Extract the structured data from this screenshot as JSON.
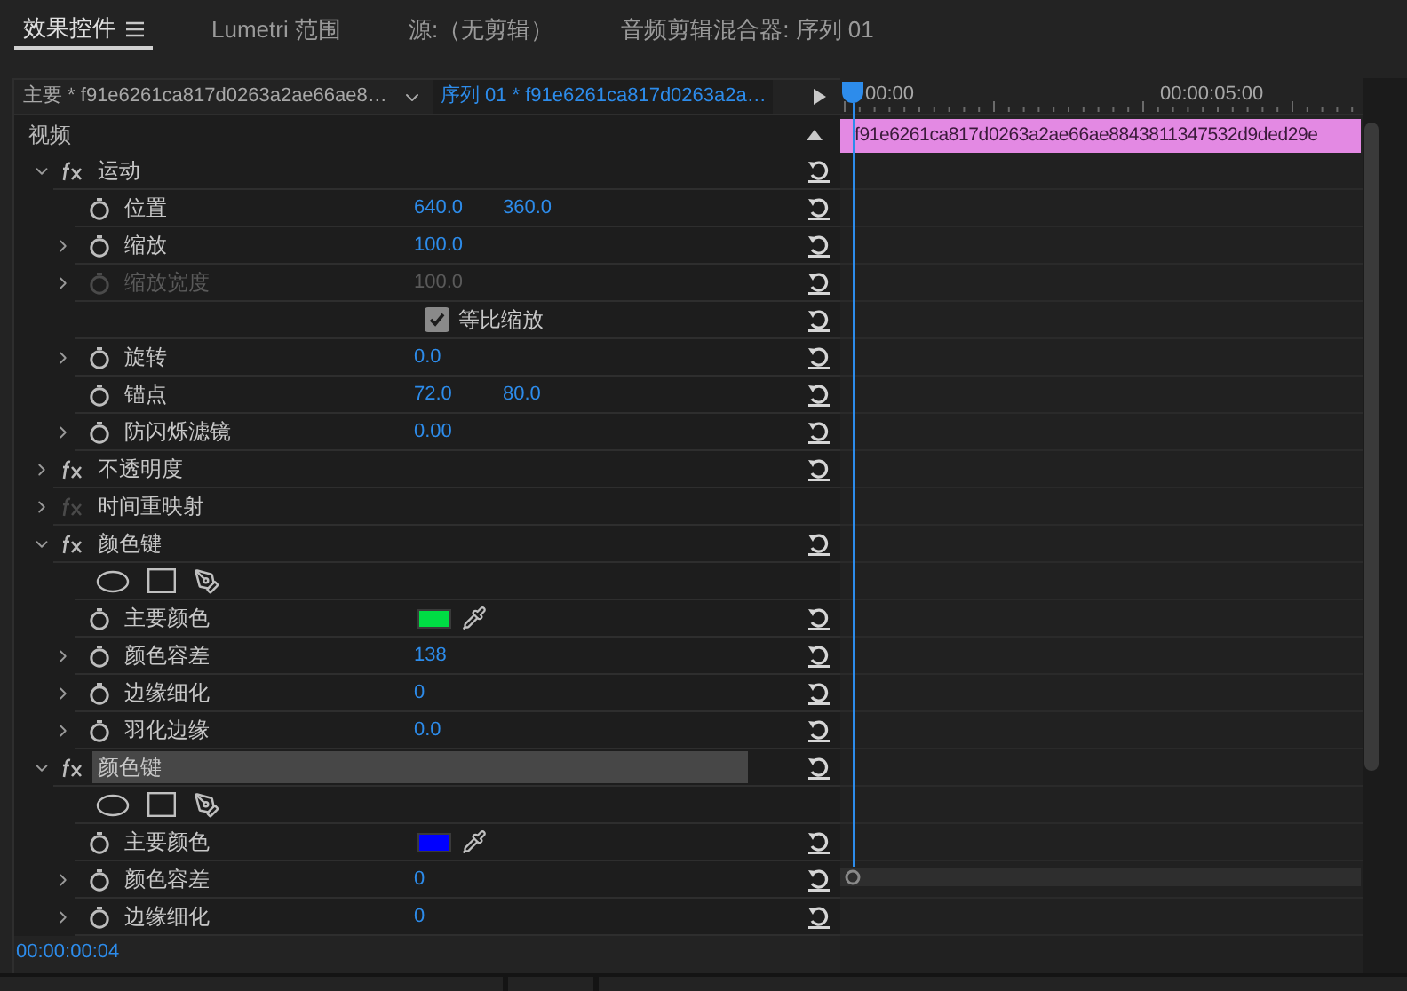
{
  "tabs": [
    {
      "label": "效果控件",
      "selected": true,
      "has_menu": true
    },
    {
      "label": "Lumetri 范围",
      "selected": false,
      "has_menu": false
    },
    {
      "label": "源:（无剪辑）",
      "selected": false,
      "has_menu": false
    },
    {
      "label": "音频剪辑混合器: 序列 01",
      "selected": false,
      "has_menu": false
    }
  ],
  "header": {
    "source": "主要 * f91e6261ca817d0263a2ae66ae8…",
    "sequence": "序列 01 * f91e6261ca817d0263a2a…"
  },
  "section": {
    "label": "视频"
  },
  "effects": [
    {
      "name": "运动",
      "expanded": true,
      "selected": false,
      "dimmed": false,
      "children": [
        {
          "kind": "value",
          "label": "位置",
          "expandable": false,
          "disabled": false,
          "values": [
            "640.0",
            "360.0"
          ]
        },
        {
          "kind": "value",
          "label": "缩放",
          "expandable": true,
          "disabled": false,
          "values": [
            "100.0"
          ]
        },
        {
          "kind": "value",
          "label": "缩放宽度",
          "expandable": true,
          "disabled": true,
          "values": [
            "100.0"
          ]
        },
        {
          "kind": "checkbox",
          "label": "等比缩放",
          "checked": true
        },
        {
          "kind": "value",
          "label": "旋转",
          "expandable": true,
          "disabled": false,
          "values": [
            "0.0"
          ]
        },
        {
          "kind": "value",
          "label": "锚点",
          "expandable": false,
          "disabled": false,
          "values": [
            "72.0",
            "80.0"
          ]
        },
        {
          "kind": "value",
          "label": "防闪烁滤镜",
          "expandable": true,
          "disabled": false,
          "values": [
            "0.00"
          ]
        }
      ]
    },
    {
      "name": "不透明度",
      "expanded": false,
      "selected": false,
      "dimmed": false
    },
    {
      "name": "时间重映射",
      "expanded": false,
      "selected": false,
      "dimmed": true
    },
    {
      "name": "颜色键",
      "expanded": true,
      "selected": false,
      "dimmed": false,
      "children": [
        {
          "kind": "mask_tools"
        },
        {
          "kind": "color",
          "label": "主要颜色",
          "color": "#00dd44"
        },
        {
          "kind": "value",
          "label": "颜色容差",
          "expandable": true,
          "disabled": false,
          "values": [
            "138"
          ]
        },
        {
          "kind": "value",
          "label": "边缘细化",
          "expandable": true,
          "disabled": false,
          "values": [
            "0"
          ]
        },
        {
          "kind": "value",
          "label": "羽化边缘",
          "expandable": true,
          "disabled": false,
          "values": [
            "0.0"
          ]
        }
      ]
    },
    {
      "name": "颜色键",
      "expanded": true,
      "selected": true,
      "dimmed": false,
      "children": [
        {
          "kind": "mask_tools"
        },
        {
          "kind": "color",
          "label": "主要颜色",
          "color": "#0000ff"
        },
        {
          "kind": "value",
          "label": "颜色容差",
          "expandable": true,
          "disabled": false,
          "values": [
            "0"
          ]
        },
        {
          "kind": "value",
          "label": "边缘细化",
          "expandable": true,
          "disabled": false,
          "values": [
            "0"
          ]
        }
      ]
    }
  ],
  "timeline": {
    "ruler": [
      "00:00",
      "00:00:05:00"
    ],
    "clip": "f91e6261ca817d0263a2ae66ae8843811347532d9ded29e"
  },
  "timecode": "00:00:00:04"
}
